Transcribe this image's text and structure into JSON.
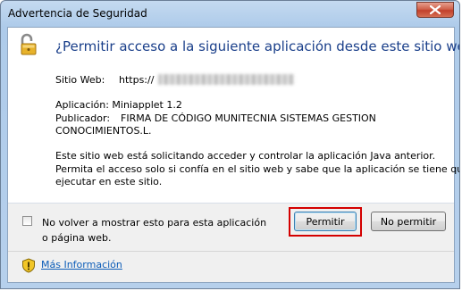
{
  "window": {
    "title": "Advertencia de Seguridad",
    "close_icon": "close-icon"
  },
  "dialog": {
    "icon": "padlock-open-icon",
    "heading": "¿Permitir acceso a la siguiente aplicación desde este sitio web?",
    "site_label": "Sitio Web:",
    "site_value": "https://",
    "application_line": "Aplicación: Miniapplet 1.2",
    "publisher_label": "Publicador:",
    "publisher_value_line1": "FIRMA DE CÓDIGO MUNITECNIA SISTEMAS GESTION",
    "publisher_value_line2": "CONOCIMIENTOS.L.",
    "description_lines": [
      "Este sitio web está solicitando acceder y controlar la aplicación Java anterior.",
      "Permita el acceso solo si confía en el sitio web y sabe que la aplicación se tiene que",
      "ejecutar en este sitio."
    ]
  },
  "footer": {
    "checkbox_checked": false,
    "checkbox_label": "No volver a mostrar esto para esta aplicación o página web.",
    "permit_label": "Permitir",
    "deny_label": "No permitir",
    "more_info_icon": "warning-shield-icon",
    "more_info_label": "Más Información"
  },
  "colors": {
    "heading": "#1a3f8a",
    "link": "#0b5cb8",
    "highlight_box": "#d40000"
  }
}
